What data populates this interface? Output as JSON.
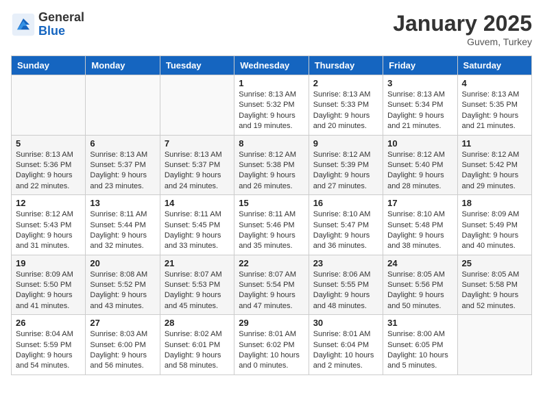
{
  "header": {
    "logo_general": "General",
    "logo_blue": "Blue",
    "month_title": "January 2025",
    "location": "Guvem, Turkey"
  },
  "weekdays": [
    "Sunday",
    "Monday",
    "Tuesday",
    "Wednesday",
    "Thursday",
    "Friday",
    "Saturday"
  ],
  "weeks": [
    [
      {
        "day": "",
        "info": ""
      },
      {
        "day": "",
        "info": ""
      },
      {
        "day": "",
        "info": ""
      },
      {
        "day": "1",
        "info": "Sunrise: 8:13 AM\nSunset: 5:32 PM\nDaylight: 9 hours\nand 19 minutes."
      },
      {
        "day": "2",
        "info": "Sunrise: 8:13 AM\nSunset: 5:33 PM\nDaylight: 9 hours\nand 20 minutes."
      },
      {
        "day": "3",
        "info": "Sunrise: 8:13 AM\nSunset: 5:34 PM\nDaylight: 9 hours\nand 21 minutes."
      },
      {
        "day": "4",
        "info": "Sunrise: 8:13 AM\nSunset: 5:35 PM\nDaylight: 9 hours\nand 21 minutes."
      }
    ],
    [
      {
        "day": "5",
        "info": "Sunrise: 8:13 AM\nSunset: 5:36 PM\nDaylight: 9 hours\nand 22 minutes."
      },
      {
        "day": "6",
        "info": "Sunrise: 8:13 AM\nSunset: 5:37 PM\nDaylight: 9 hours\nand 23 minutes."
      },
      {
        "day": "7",
        "info": "Sunrise: 8:13 AM\nSunset: 5:37 PM\nDaylight: 9 hours\nand 24 minutes."
      },
      {
        "day": "8",
        "info": "Sunrise: 8:12 AM\nSunset: 5:38 PM\nDaylight: 9 hours\nand 26 minutes."
      },
      {
        "day": "9",
        "info": "Sunrise: 8:12 AM\nSunset: 5:39 PM\nDaylight: 9 hours\nand 27 minutes."
      },
      {
        "day": "10",
        "info": "Sunrise: 8:12 AM\nSunset: 5:40 PM\nDaylight: 9 hours\nand 28 minutes."
      },
      {
        "day": "11",
        "info": "Sunrise: 8:12 AM\nSunset: 5:42 PM\nDaylight: 9 hours\nand 29 minutes."
      }
    ],
    [
      {
        "day": "12",
        "info": "Sunrise: 8:12 AM\nSunset: 5:43 PM\nDaylight: 9 hours\nand 31 minutes."
      },
      {
        "day": "13",
        "info": "Sunrise: 8:11 AM\nSunset: 5:44 PM\nDaylight: 9 hours\nand 32 minutes."
      },
      {
        "day": "14",
        "info": "Sunrise: 8:11 AM\nSunset: 5:45 PM\nDaylight: 9 hours\nand 33 minutes."
      },
      {
        "day": "15",
        "info": "Sunrise: 8:11 AM\nSunset: 5:46 PM\nDaylight: 9 hours\nand 35 minutes."
      },
      {
        "day": "16",
        "info": "Sunrise: 8:10 AM\nSunset: 5:47 PM\nDaylight: 9 hours\nand 36 minutes."
      },
      {
        "day": "17",
        "info": "Sunrise: 8:10 AM\nSunset: 5:48 PM\nDaylight: 9 hours\nand 38 minutes."
      },
      {
        "day": "18",
        "info": "Sunrise: 8:09 AM\nSunset: 5:49 PM\nDaylight: 9 hours\nand 40 minutes."
      }
    ],
    [
      {
        "day": "19",
        "info": "Sunrise: 8:09 AM\nSunset: 5:50 PM\nDaylight: 9 hours\nand 41 minutes."
      },
      {
        "day": "20",
        "info": "Sunrise: 8:08 AM\nSunset: 5:52 PM\nDaylight: 9 hours\nand 43 minutes."
      },
      {
        "day": "21",
        "info": "Sunrise: 8:07 AM\nSunset: 5:53 PM\nDaylight: 9 hours\nand 45 minutes."
      },
      {
        "day": "22",
        "info": "Sunrise: 8:07 AM\nSunset: 5:54 PM\nDaylight: 9 hours\nand 47 minutes."
      },
      {
        "day": "23",
        "info": "Sunrise: 8:06 AM\nSunset: 5:55 PM\nDaylight: 9 hours\nand 48 minutes."
      },
      {
        "day": "24",
        "info": "Sunrise: 8:05 AM\nSunset: 5:56 PM\nDaylight: 9 hours\nand 50 minutes."
      },
      {
        "day": "25",
        "info": "Sunrise: 8:05 AM\nSunset: 5:58 PM\nDaylight: 9 hours\nand 52 minutes."
      }
    ],
    [
      {
        "day": "26",
        "info": "Sunrise: 8:04 AM\nSunset: 5:59 PM\nDaylight: 9 hours\nand 54 minutes."
      },
      {
        "day": "27",
        "info": "Sunrise: 8:03 AM\nSunset: 6:00 PM\nDaylight: 9 hours\nand 56 minutes."
      },
      {
        "day": "28",
        "info": "Sunrise: 8:02 AM\nSunset: 6:01 PM\nDaylight: 9 hours\nand 58 minutes."
      },
      {
        "day": "29",
        "info": "Sunrise: 8:01 AM\nSunset: 6:02 PM\nDaylight: 10 hours\nand 0 minutes."
      },
      {
        "day": "30",
        "info": "Sunrise: 8:01 AM\nSunset: 6:04 PM\nDaylight: 10 hours\nand 2 minutes."
      },
      {
        "day": "31",
        "info": "Sunrise: 8:00 AM\nSunset: 6:05 PM\nDaylight: 10 hours\nand 5 minutes."
      },
      {
        "day": "",
        "info": ""
      }
    ]
  ]
}
